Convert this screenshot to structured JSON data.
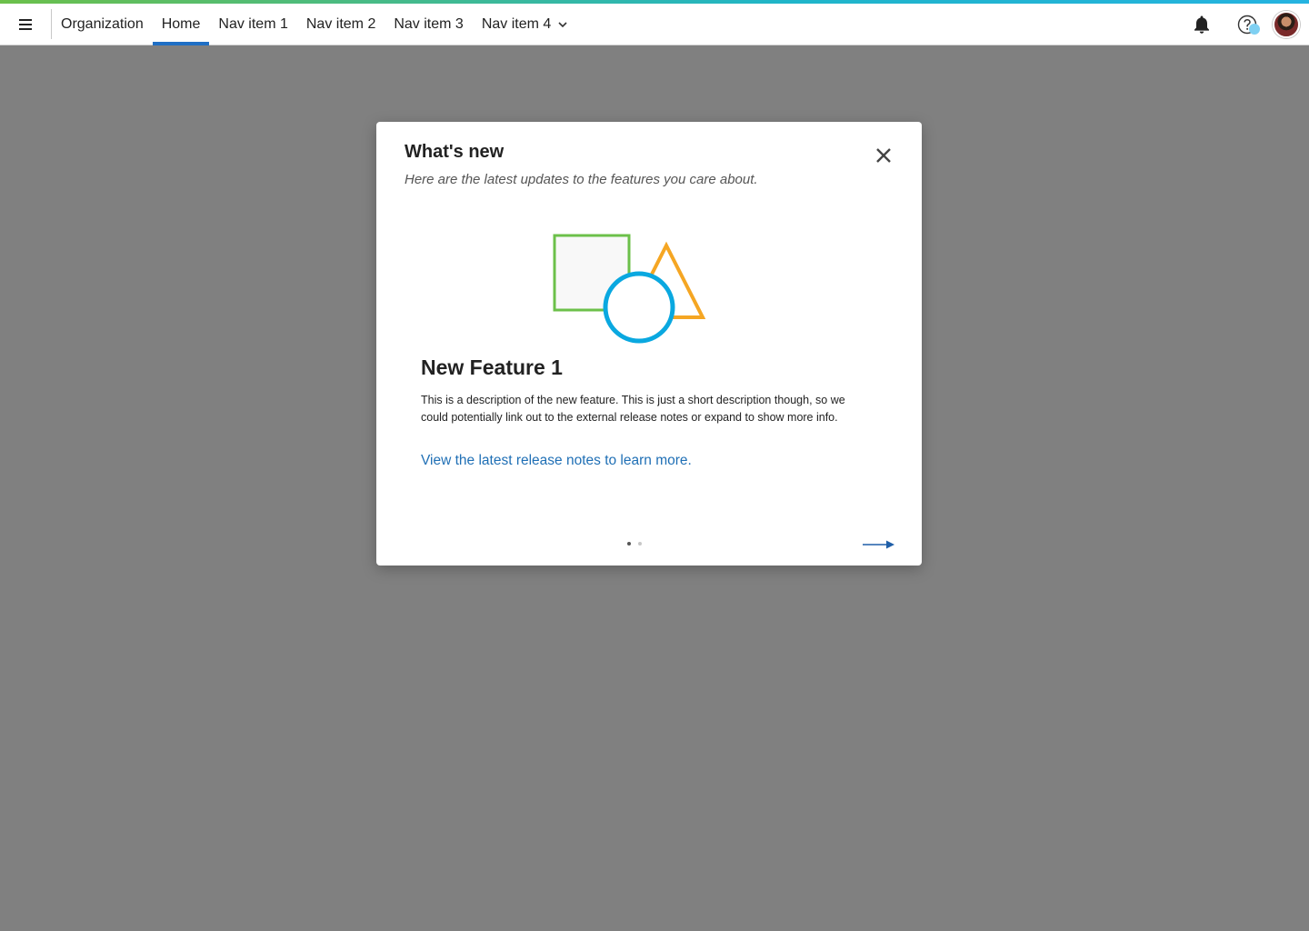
{
  "colors": {
    "accent_blue": "#1f6fc5",
    "link_blue": "#1f6fb5",
    "overlay": "#808080",
    "shape_square": "#6cc04a",
    "shape_triangle": "#f5a623",
    "shape_circle": "#0aa8e0"
  },
  "header": {
    "menu_icon": "hamburger-icon",
    "organization_label": "Organization",
    "nav_items": [
      "Home",
      "Nav item 1",
      "Nav item 2",
      "Nav item 3",
      "Nav item 4"
    ],
    "active_item": "Home",
    "dropdown_icon": "chevron-down-icon",
    "right_icons": [
      "bell-icon",
      "help-icon",
      "avatar"
    ]
  },
  "modal": {
    "title": "What's new",
    "subtitle": "Here are the latest updates to the features you care about.",
    "close_icon": "close-icon",
    "feature": {
      "title": "New Feature 1",
      "description": "This is a description of the new feature.  This is just a short description though, so we could potentially link out to the external release notes or expand to show more info.",
      "link_text": "View the latest release notes to learn more."
    },
    "pager": {
      "total": 2,
      "current": 1
    },
    "next_icon": "arrow-right-icon"
  }
}
